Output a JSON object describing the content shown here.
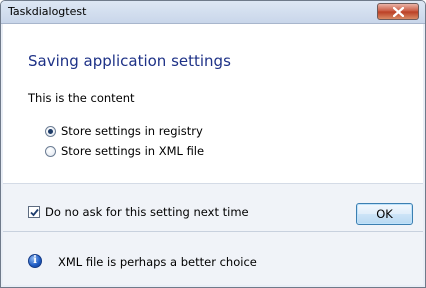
{
  "window": {
    "title": "Taskdialogtest"
  },
  "dialog": {
    "main_instruction": "Saving application settings",
    "content": "This is the content",
    "radios": [
      {
        "label": "Store settings in registry",
        "checked": true
      },
      {
        "label": "Store settings in XML file",
        "checked": false
      }
    ],
    "verification": {
      "label": "Do no ask for this setting next time",
      "checked": true
    },
    "ok_label": "OK",
    "footer_icon": "info-icon",
    "footer_text": "XML file is perhaps a better choice"
  }
}
